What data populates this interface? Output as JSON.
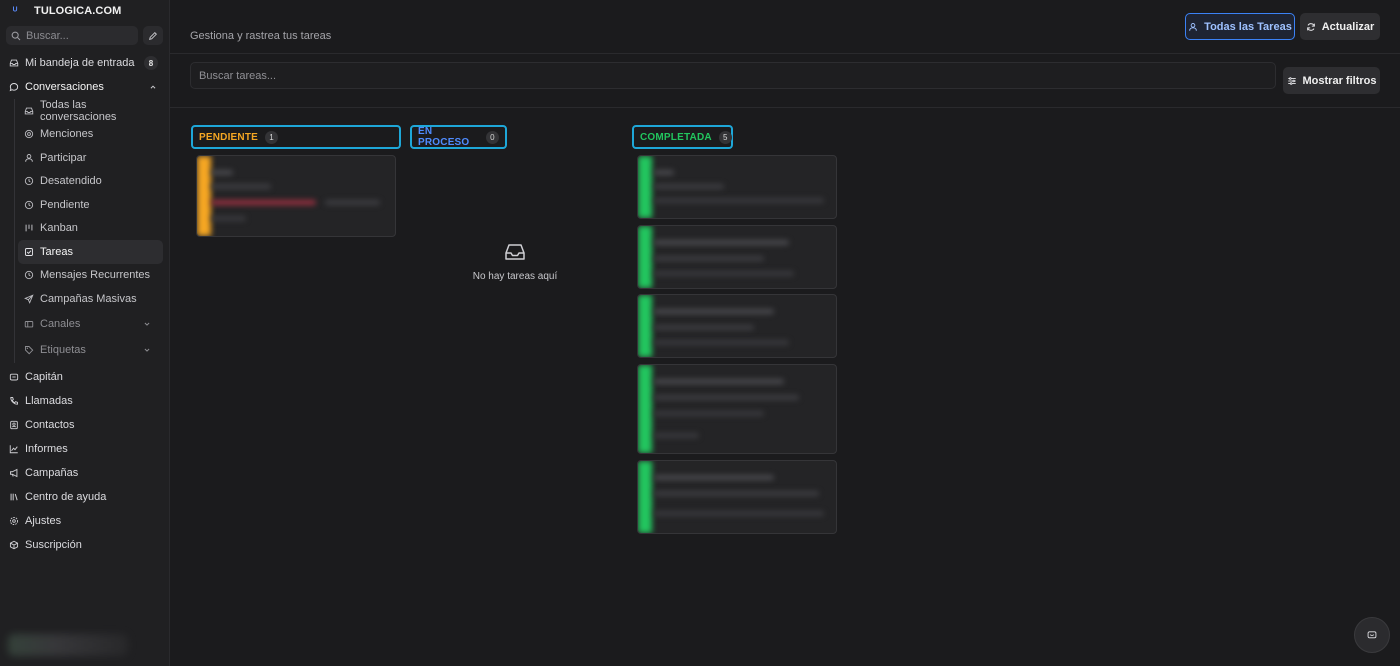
{
  "brand": {
    "logo": "ᵁ",
    "name": "TULOGICA.COM"
  },
  "sidebar": {
    "search_placeholder": "Buscar...",
    "top_items": [
      {
        "label": "Mi bandeja de entrada",
        "badge": "8",
        "icon": "inbox-icon"
      },
      {
        "label": "Conversaciones",
        "icon": "chat-icon"
      }
    ],
    "conversation_items": [
      {
        "label": "Todas las conversaciones",
        "icon": "inbox-icon"
      },
      {
        "label": "Menciones",
        "icon": "at-icon"
      },
      {
        "label": "Participar",
        "icon": "user-icon"
      },
      {
        "label": "Desatendido",
        "icon": "clock-icon"
      },
      {
        "label": "Pendiente",
        "icon": "clock-icon"
      },
      {
        "label": "Kanban",
        "icon": "kanban-icon"
      },
      {
        "label": "Tareas",
        "icon": "checkbox-icon"
      },
      {
        "label": "Mensajes Recurrentes",
        "icon": "repeat-icon"
      },
      {
        "label": "Campañas Masivas",
        "icon": "send-icon"
      },
      {
        "label": "Canales",
        "icon": "channels-icon"
      },
      {
        "label": "Etiquetas",
        "icon": "tag-icon"
      }
    ],
    "bottom_items": [
      {
        "label": "Capitán",
        "icon": "bot-icon"
      },
      {
        "label": "Llamadas",
        "icon": "phone-icon"
      },
      {
        "label": "Contactos",
        "icon": "contacts-icon"
      },
      {
        "label": "Informes",
        "icon": "chart-icon"
      },
      {
        "label": "Campañas",
        "icon": "megaphone-icon"
      },
      {
        "label": "Centro de ayuda",
        "icon": "library-icon"
      },
      {
        "label": "Ajustes",
        "icon": "gear-icon"
      },
      {
        "label": "Suscripción",
        "icon": "package-icon"
      }
    ]
  },
  "header": {
    "subtitle": "Gestiona y rastrea tus tareas",
    "all_tasks_label": "Todas las Tareas",
    "refresh_label": "Actualizar"
  },
  "filters": {
    "search_placeholder": "Buscar tareas...",
    "show_filters_label": "Mostrar filtros"
  },
  "columns": [
    {
      "title": "PENDIENTE",
      "count": "1",
      "color": "#f5a623"
    },
    {
      "title": "EN PROCESO",
      "count": "0",
      "color": "#4f8cff",
      "empty_text": "No hay tareas aquí"
    },
    {
      "title": "COMPLETADA",
      "count": "5",
      "color": "#22c55e"
    }
  ],
  "colors": {
    "accent": "#3b82f6",
    "column_border": "#1ea7d8",
    "pending": "#f5a623",
    "done": "#22c55e"
  }
}
